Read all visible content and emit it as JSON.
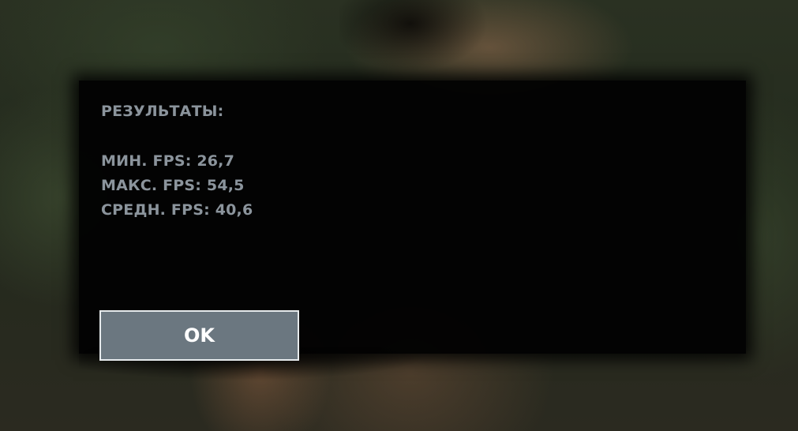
{
  "results": {
    "heading": "РЕЗУЛЬТАТЫ:",
    "min_fps": "МИН. FPS: 26,7",
    "max_fps": "МАКС. FPS: 54,5",
    "avg_fps": "СРЕДН. FPS: 40,6"
  },
  "ok_button": {
    "label": "OK"
  },
  "colors": {
    "text": "#8b949c",
    "button_fill": "#6b7780",
    "button_border": "#e6eaec",
    "panel": "#020202"
  }
}
